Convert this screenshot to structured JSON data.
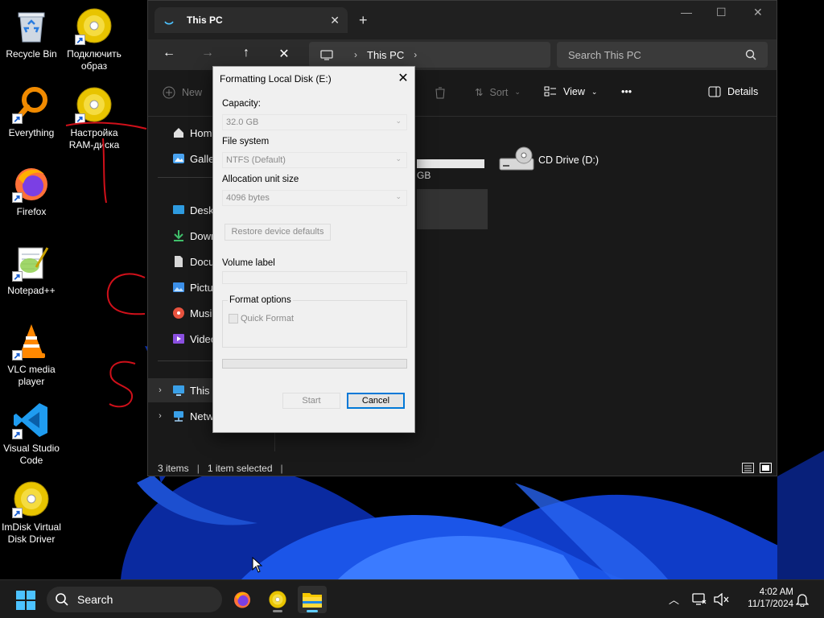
{
  "desktop": {
    "icons": [
      {
        "label": "Recycle Bin",
        "icon": "recycle-bin-icon"
      },
      {
        "label": "Подключить образ",
        "icon": "disc-image-icon"
      },
      {
        "label": "Everything",
        "icon": "everything-search-icon"
      },
      {
        "label": "Настройка RAM-диска",
        "icon": "disc-image-icon"
      },
      {
        "label": "Firefox",
        "icon": "firefox-icon"
      },
      {
        "label": "Notepad++",
        "icon": "notepad-plus-plus-icon"
      },
      {
        "label": "VLC media player",
        "icon": "vlc-icon"
      },
      {
        "label": "Visual Studio Code",
        "icon": "vscode-icon"
      },
      {
        "label": "ImDisk Virtual Disk Driver",
        "icon": "disc-image-icon"
      }
    ]
  },
  "explorer": {
    "tab_title": "This PC",
    "new_tab": "+",
    "window_controls": {
      "minimize": "—",
      "maximize": "☐",
      "close": "✕"
    },
    "breadcrumb": [
      "This PC"
    ],
    "search_placeholder": "Search This PC",
    "commands": {
      "new": "New",
      "sort": "Sort",
      "view": "View",
      "more": "•••",
      "details": "Details"
    },
    "sidebar": [
      {
        "label": "Home",
        "icon": "home-icon"
      },
      {
        "label": "Gallery",
        "icon": "gallery-icon"
      },
      {
        "label": "Desktop",
        "icon": "desktop-folder-icon"
      },
      {
        "label": "Downloads",
        "icon": "downloads-icon"
      },
      {
        "label": "Documents",
        "icon": "documents-icon"
      },
      {
        "label": "Pictures",
        "icon": "pictures-icon"
      },
      {
        "label": "Music",
        "icon": "music-icon"
      },
      {
        "label": "Videos",
        "icon": "videos-icon"
      },
      {
        "label": "This PC",
        "icon": "this-pc-icon"
      },
      {
        "label": "Network",
        "icon": "network-icon"
      }
    ],
    "drive_partial_size": "GB",
    "cd_drive": "CD Drive (D:)",
    "status": {
      "items": "3 items",
      "selected": "1 item selected"
    }
  },
  "dialog": {
    "title": "Formatting Local Disk (E:)",
    "capacity_label": "Capacity:",
    "capacity_value": "32.0 GB",
    "filesystem_label": "File system",
    "filesystem_value": "NTFS (Default)",
    "allocation_label": "Allocation unit size",
    "allocation_value": "4096 bytes",
    "restore_button": "Restore device defaults",
    "volume_label": "Volume label",
    "volume_value": "",
    "format_options": "Format options",
    "quick_format": "Quick Format",
    "quick_format_checked": true,
    "progress": 0,
    "start_button": "Start",
    "cancel_button": "Cancel"
  },
  "taskbar": {
    "search_label": "Search",
    "time": "4:02 AM",
    "date": "11/17/2024"
  },
  "colors": {
    "accent": "#0078d7",
    "taskbar_active": "#60cdff",
    "folder_yellow": "#f9c900"
  }
}
